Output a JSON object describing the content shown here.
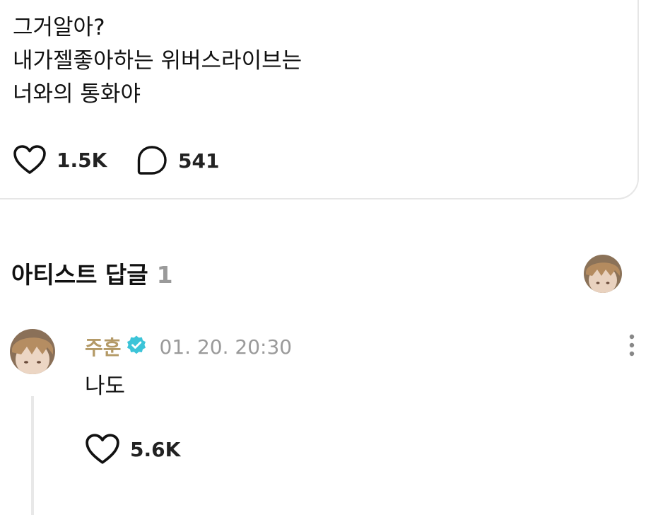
{
  "post": {
    "lines": [
      "그거알아?",
      "내가젤좋아하는 위버스라이브는",
      "너와의 통화야"
    ],
    "likes": "1.5K",
    "comments": "541"
  },
  "section": {
    "title": "아티스트 답글",
    "count": "1"
  },
  "reply": {
    "author": "주훈",
    "timestamp": "01. 20. 20:30",
    "text": "나도",
    "likes": "5.6K"
  },
  "colors": {
    "author_name": "#b49a67",
    "verified_badge": "#3cc4d8",
    "muted_text": "#9a9a9a"
  },
  "icons": [
    "heart-icon",
    "comment-bubble-icon",
    "verified-badge-icon",
    "more-vertical-icon"
  ]
}
